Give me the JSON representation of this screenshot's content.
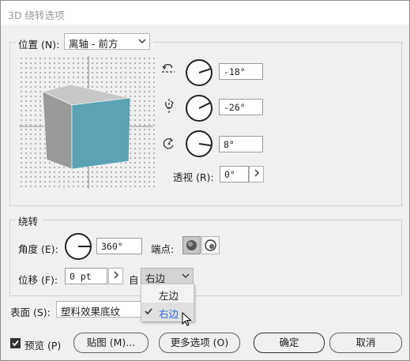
{
  "dialog": {
    "title": "3D 绕转选项"
  },
  "position": {
    "label": "位置 (N):",
    "selected": "离轴 - 前方",
    "rotations": [
      {
        "icon": "x-axis-rotate-icon",
        "value": "-18°",
        "dial_angle_deg": -18
      },
      {
        "icon": "y-axis-rotate-icon",
        "value": "-26°",
        "dial_angle_deg": -26
      },
      {
        "icon": "z-axis-rotate-icon",
        "value": "8°",
        "dial_angle_deg": 8
      }
    ],
    "perspective_label": "透视 (R):",
    "perspective_value": "0°"
  },
  "revolve": {
    "section_label": "绕转",
    "angle_label": "角度 (E):",
    "angle_value": "360°",
    "cap_label": "端点:",
    "offset_label": "位移 (F):",
    "offset_value": "0 pt",
    "from_label": "自",
    "from_selected": "右边",
    "from_options": [
      "左边",
      "右边"
    ]
  },
  "surface": {
    "label": "表面 (S):",
    "selected": "塑料效果底纹"
  },
  "footer": {
    "preview_label": "预览 (P)",
    "preview_checked": true,
    "map_art_label": "贴图 (M)...",
    "more_options_label": "更多选项 (O)",
    "ok_label": "确定",
    "cancel_label": "取消"
  },
  "colors": {
    "cube_front": "#5ba2b5",
    "cube_top": "#c8c8c8",
    "cube_side": "#9a9a9a",
    "selected_option": "#2b6cd6"
  }
}
